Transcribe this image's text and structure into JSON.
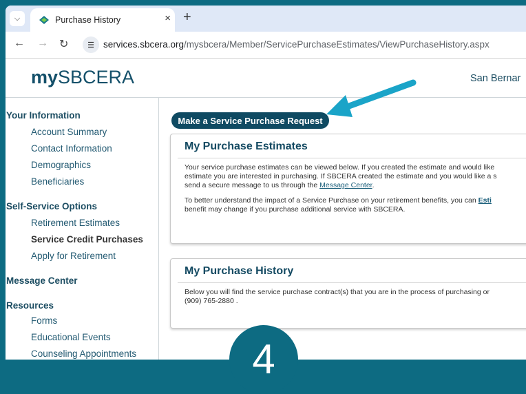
{
  "browser": {
    "tab_title": "Purchase History",
    "tab_close": "×",
    "new_tab": "+",
    "url_host": "services.sbcera.org",
    "url_path": "/mysbcera/Member/ServicePurchaseEstimates/ViewPurchaseHistory.aspx"
  },
  "header": {
    "logo_prefix": "my",
    "logo_suffix": "SBCERA",
    "org_name": "San Bernar"
  },
  "sidebar": {
    "your_information": {
      "heading": "Your Information",
      "items": [
        "Account Summary",
        "Contact Information",
        "Demographics",
        "Beneficiaries"
      ]
    },
    "self_service": {
      "heading": "Self-Service Options",
      "items": [
        "Retirement Estimates",
        "Service Credit Purchases",
        "Apply for Retirement"
      ],
      "active": "Service Credit Purchases"
    },
    "message_center": {
      "heading": "Message Center"
    },
    "resources": {
      "heading": "Resources",
      "items": [
        "Forms",
        "Educational Events",
        "Counseling Appointments"
      ]
    }
  },
  "main": {
    "request_button": "Make a Service Purchase Request",
    "estimates": {
      "title": "My Purchase Estimates",
      "line1": "Your service purchase estimates can be viewed below. If you created the estimate and would like",
      "line2": "estimate you are interested in purchasing. If SBCERA created the estimate and you would like a s",
      "line3_pre": "send a secure message to us through the ",
      "line3_link": "Message Center",
      "line3_post": ".",
      "line4_pre": "To better understand the impact of a Service Purchase on your retirement benefits, you can ",
      "line4_link": "Esti",
      "line5": "benefit may change if you purchase additional service with SBCERA."
    },
    "history": {
      "title": "My Purchase History",
      "line1": "Below you will find the service purchase contract(s) that you are in the process of purchasing or",
      "line2": "(909) 765-2880 ."
    }
  },
  "overlay": {
    "step_number": "4",
    "arrow_color": "#1aa4c8",
    "badge_color": "#0d6b82"
  }
}
